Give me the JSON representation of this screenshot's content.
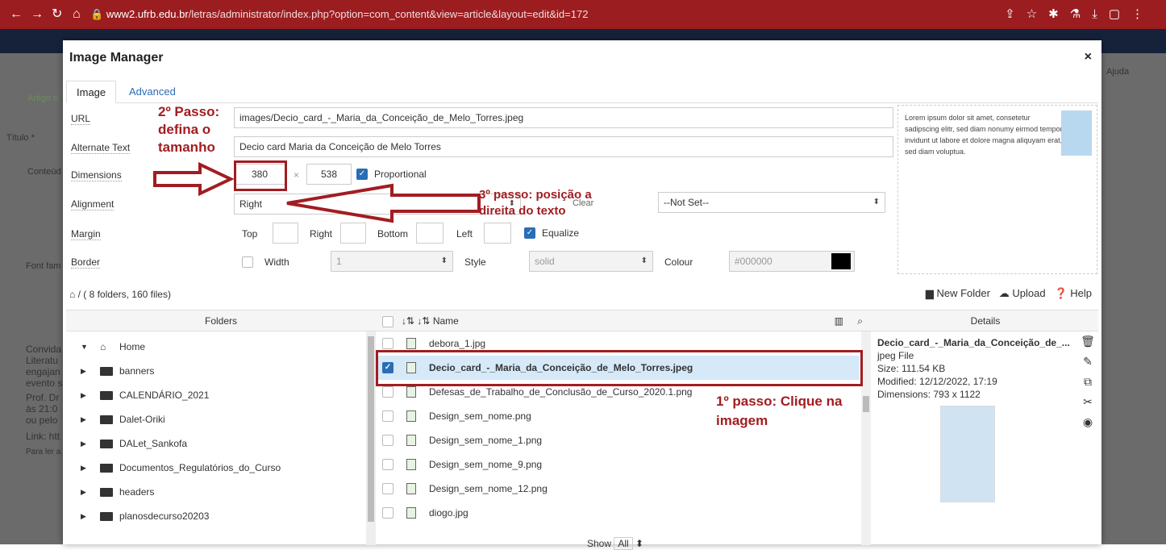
{
  "browser": {
    "domain": "www2.ufrb.edu.br",
    "path": "/letras/administrator/index.php?option=com_content&view=article&layout=edit&id=172"
  },
  "background": {
    "article_tab": "Artigo s",
    "title_label": "Título *",
    "content_tab": "Conteúd",
    "font_label": "Font fam",
    "help_label": "Ajuda",
    "text_lines": [
      "Convida",
      "Literatu",
      "engajan",
      "evento s",
      "Prof. Dr",
      "às 21:0",
      "ou pelo",
      "Link: htt",
      "Para ler a"
    ]
  },
  "modal": {
    "title": "Image Manager",
    "close": "×",
    "tabs": [
      "Image",
      "Advanced"
    ],
    "form": {
      "url_label": "URL",
      "url_value": "images/Decio_card_-_Maria_da_Conceição_de_Melo_Torres.jpeg",
      "alt_label": "Alternate Text",
      "alt_value": "Decio card Maria da Conceição de Melo Torres",
      "dimensions_label": "Dimensions",
      "width": "380",
      "times": "×",
      "height": "538",
      "proportional": "Proportional",
      "alignment_label": "Alignment",
      "alignment_value": "Right",
      "clear_label": "Clear",
      "clear_value": "--Not Set--",
      "margin_label": "Margin",
      "margin_top": "Top",
      "margin_right": "Right",
      "margin_bottom": "Bottom",
      "margin_left": "Left",
      "equalize": "Equalize",
      "border_label": "Border",
      "border_width_label": "Width",
      "border_width_value": "1",
      "border_style_label": "Style",
      "border_style_value": "solid",
      "border_colour_label": "Colour",
      "border_colour_value": "#000000"
    },
    "preview_text": "Lorem ipsum dolor sit amet, consetetur sadipscing elitr, sed diam nonumy eirmod tempor invidunt ut labore et dolore magna aliquyam erat, sed diam voluptua.",
    "path": "/ ( 8 folders, 160 files)",
    "toolbar": {
      "new_folder": "New Folder",
      "upload": "Upload",
      "help": "Help"
    },
    "columns": {
      "folders": "Folders",
      "name": "Name",
      "details": "Details"
    },
    "folders": [
      "Home",
      "banners",
      "CALENDÁRIO_2021",
      "Dalet-Oriki",
      "DALet_Sankofa",
      "Documentos_Regulatórios_do_Curso",
      "headers",
      "planosdecurso20203"
    ],
    "files": [
      "debora_1.jpg",
      "Decio_card_-_Maria_da_Conceição_de_Melo_Torres.jpeg",
      "Defesas_de_Trabalho_de_Conclusão_de_Curso_2020.1.png",
      "Design_sem_nome.png",
      "Design_sem_nome_1.png",
      "Design_sem_nome_9.png",
      "Design_sem_nome_12.png",
      "diogo.jpg"
    ],
    "details": {
      "name": "Decio_card_-_Maria_da_Conceição_de_...",
      "type": "jpeg File",
      "size": "Size: 111.54 KB",
      "modified": "Modified: 12/12/2022, 17:19",
      "dimensions": "Dimensions: 793 x 1122"
    },
    "show_label": "Show",
    "show_value": "All"
  },
  "annotations": {
    "step2": "2º Passo: defina o tamanho",
    "step3": "3º passo: posição a direita do texto",
    "step1": "1º passo: Clique na imagem"
  },
  "colors": {
    "browser_bar": "#9b1d20",
    "annotation": "#a11d21",
    "accent": "#2a6db5"
  }
}
